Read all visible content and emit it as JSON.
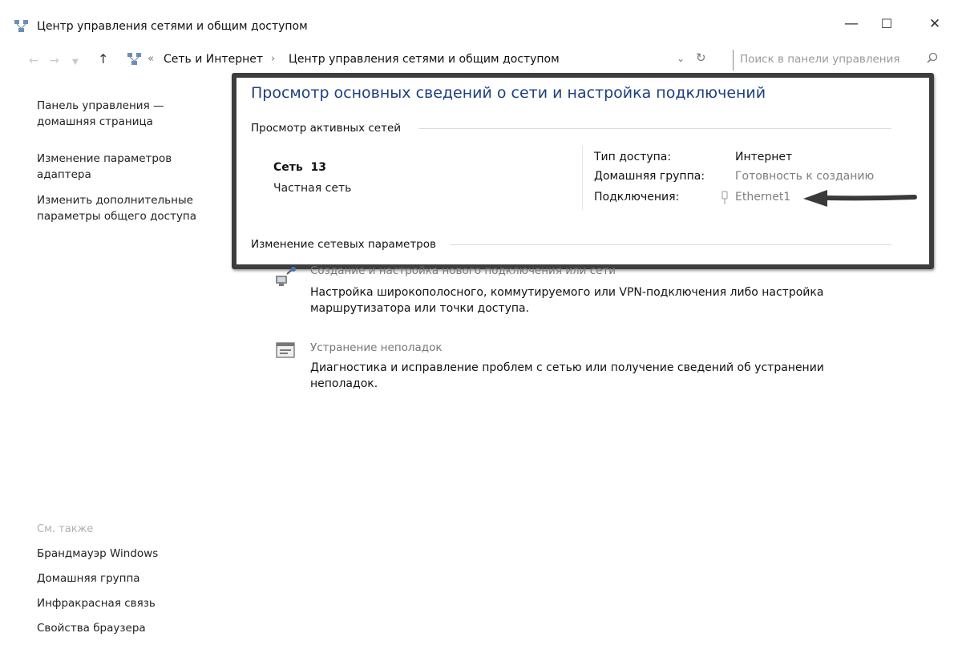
{
  "window": {
    "title": "Центр управления сетями и общим доступом",
    "minimize_symbol": "—",
    "maximize_symbol": "☐",
    "close_symbol": "✕"
  },
  "address_bar": {
    "overflow_symbol": "«",
    "breadcrumb": [
      "Сеть и Интернет",
      "Центр управления сетями и общим доступом"
    ],
    "separator": "›",
    "search_placeholder": "Поиск в панели управления"
  },
  "sidebar": {
    "links": [
      {
        "label": "Панель управления —\nдомашняя страница"
      },
      {
        "label": "Изменение параметров\nадаптера"
      },
      {
        "label": "Изменить дополнительные\nпараметры общего доступа"
      }
    ],
    "see_also_heading": "См. также",
    "see_also": [
      "Брандмауэр Windows",
      "Домашняя группа",
      "Инфракрасная связь",
      "Свойства браузера"
    ]
  },
  "main": {
    "heading": "Просмотр основных сведений о сети и настройка подключений",
    "active_networks_label": "Просмотр активных сетей",
    "network": {
      "name": "Сеть  13",
      "type": "Частная сеть"
    },
    "properties": [
      {
        "key": "Тип доступа:",
        "value": "Интернет"
      },
      {
        "key": "Домашняя группа:",
        "value": "Готовность к созданию"
      },
      {
        "key": "Подключения:",
        "value": "Ethernet1"
      }
    ],
    "change_settings_label": "Изменение сетевых параметров",
    "tasks": [
      {
        "title": "Создание и настройка нового подключения или сети",
        "description": "Настройка широкополосного, коммутируемого или VPN-подключения либо настройка маршрутизатора или точки доступа."
      },
      {
        "title": "Устранение неполадок",
        "description": "Диагностика и исправление проблем с сетью или получение сведений об устранении неполадок."
      }
    ]
  },
  "colors": {
    "heading_blue": "#1e3f80",
    "frame": "#3d3d3d",
    "link_grey": "#7e7e7e"
  }
}
